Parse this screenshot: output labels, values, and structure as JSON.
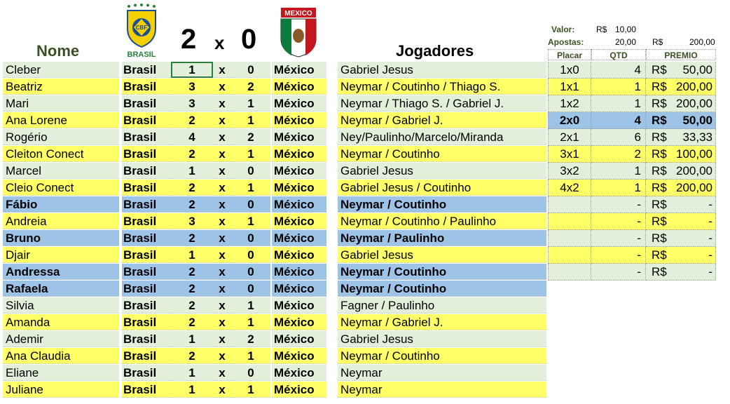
{
  "header": {
    "nome_label": "Nome",
    "jogadores_label": "Jogadores",
    "score_home": "2",
    "score_x": "x",
    "score_away": "0",
    "brasil_logo_text": "CBF",
    "brasil_logo_caption": "BRASIL",
    "mexico_logo_caption": "MEXICO"
  },
  "info": {
    "valor_label": "Valor:",
    "valor_currency": "R$",
    "valor_value": "10,00",
    "apostas_label": "Apostas:",
    "apostas_value": "20,00",
    "total_currency": "R$",
    "total_value": "200,00"
  },
  "colors": {
    "green_row": "#e2efda",
    "yellow_row": "#ffff66",
    "blue_row": "#9dc3e6",
    "header_green": "#3d4f24"
  },
  "bets": [
    {
      "nome": "Cleber",
      "time1": "Brasil",
      "g1": "1",
      "x": "x",
      "g2": "0",
      "time2": "México",
      "jogadores": "Gabriel Jesus",
      "color": "#e2efda",
      "winner": false
    },
    {
      "nome": "Beatriz",
      "time1": "Brasil",
      "g1": "3",
      "x": "x",
      "g2": "2",
      "time2": "México",
      "jogadores": "Neymar / Coutinho / Thiago S.",
      "color": "#ffff66",
      "winner": false
    },
    {
      "nome": "Mari",
      "time1": "Brasil",
      "g1": "3",
      "x": "x",
      "g2": "1",
      "time2": "México",
      "jogadores": "Neymar / Thiago S. / Gabriel J.",
      "color": "#e2efda",
      "winner": false
    },
    {
      "nome": "Ana Lorene",
      "time1": "Brasil",
      "g1": "2",
      "x": "x",
      "g2": "1",
      "time2": "México",
      "jogadores": "Neymar / Gabriel J.",
      "color": "#ffff66",
      "winner": false
    },
    {
      "nome": "Rogério",
      "time1": "Brasil",
      "g1": "4",
      "x": "x",
      "g2": "2",
      "time2": "México",
      "jogadores": "Ney/Paulinho/Marcelo/Miranda",
      "color": "#e2efda",
      "winner": false
    },
    {
      "nome": "Cleiton Conect",
      "time1": "Brasil",
      "g1": "2",
      "x": "x",
      "g2": "1",
      "time2": "México",
      "jogadores": "Neymar / Coutinho",
      "color": "#ffff66",
      "winner": false
    },
    {
      "nome": "Marcel",
      "time1": "Brasil",
      "g1": "1",
      "x": "x",
      "g2": "0",
      "time2": "México",
      "jogadores": "Gabriel Jesus",
      "color": "#e2efda",
      "winner": false
    },
    {
      "nome": "Cleio Conect",
      "time1": "Brasil",
      "g1": "2",
      "x": "x",
      "g2": "1",
      "time2": "México",
      "jogadores": "Gabriel Jesus / Coutinho",
      "color": "#ffff66",
      "winner": false
    },
    {
      "nome": "Fábio",
      "time1": "Brasil",
      "g1": "2",
      "x": "x",
      "g2": "0",
      "time2": "México",
      "jogadores": "Neymar / Coutinho",
      "color": "#9dc3e6",
      "winner": true
    },
    {
      "nome": "Andreia",
      "time1": "Brasil",
      "g1": "3",
      "x": "x",
      "g2": "1",
      "time2": "México",
      "jogadores": "Neymar / Coutinho / Paulinho",
      "color": "#ffff66",
      "winner": false
    },
    {
      "nome": "Bruno",
      "time1": "Brasil",
      "g1": "2",
      "x": "x",
      "g2": "0",
      "time2": "México",
      "jogadores": "Neymar / Paulinho",
      "color": "#9dc3e6",
      "winner": true
    },
    {
      "nome": "Djair",
      "time1": "Brasil",
      "g1": "1",
      "x": "x",
      "g2": "0",
      "time2": "México",
      "jogadores": "Gabriel Jesus",
      "color": "#ffff66",
      "winner": false
    },
    {
      "nome": "Andressa",
      "time1": "Brasil",
      "g1": "2",
      "x": "x",
      "g2": "0",
      "time2": "México",
      "jogadores": "Neymar / Coutinho",
      "color": "#9dc3e6",
      "winner": true
    },
    {
      "nome": "Rafaela",
      "time1": "Brasil",
      "g1": "2",
      "x": "x",
      "g2": "0",
      "time2": "México",
      "jogadores": "Neymar / Coutinho",
      "color": "#9dc3e6",
      "winner": true
    },
    {
      "nome": "Silvia",
      "time1": "Brasil",
      "g1": "2",
      "x": "x",
      "g2": "1",
      "time2": "México",
      "jogadores": "Fagner / Paulinho",
      "color": "#e2efda",
      "winner": false
    },
    {
      "nome": "Amanda",
      "time1": "Brasil",
      "g1": "2",
      "x": "x",
      "g2": "1",
      "time2": "México",
      "jogadores": "Neymar / Gabriel J.",
      "color": "#ffff66",
      "winner": false
    },
    {
      "nome": "Ademir",
      "time1": "Brasil",
      "g1": "1",
      "x": "x",
      "g2": "2",
      "time2": "México",
      "jogadores": "Gabriel Jesus",
      "color": "#e2efda",
      "winner": false
    },
    {
      "nome": "Ana Claudia",
      "time1": "Brasil",
      "g1": "2",
      "x": "x",
      "g2": "1",
      "time2": "México",
      "jogadores": "Neymar / Coutinho",
      "color": "#ffff66",
      "winner": false
    },
    {
      "nome": "Eliane",
      "time1": "Brasil",
      "g1": "1",
      "x": "x",
      "g2": "0",
      "time2": "México",
      "jogadores": "Neymar",
      "color": "#e2efda",
      "winner": false
    },
    {
      "nome": "Juliane",
      "time1": "Brasil",
      "g1": "1",
      "x": "x",
      "g2": "1",
      "time2": "México",
      "jogadores": "Neymar",
      "color": "#ffff66",
      "winner": false
    }
  ],
  "prize_table": {
    "headers": [
      "Placar",
      "QTD",
      "PREMIO"
    ],
    "rows": [
      {
        "placar": "1x0",
        "qtd": "4",
        "currency": "R$",
        "premio": "50,00",
        "color": "#e2efda",
        "highlight": false
      },
      {
        "placar": "1x1",
        "qtd": "1",
        "currency": "R$",
        "premio": "200,00",
        "color": "#ffff66",
        "highlight": false
      },
      {
        "placar": "1x2",
        "qtd": "1",
        "currency": "R$",
        "premio": "200,00",
        "color": "#e2efda",
        "highlight": false
      },
      {
        "placar": "2x0",
        "qtd": "4",
        "currency": "R$",
        "premio": "50,00",
        "color": "#9dc3e6",
        "highlight": true
      },
      {
        "placar": "2x1",
        "qtd": "6",
        "currency": "R$",
        "premio": "33,33",
        "color": "#e2efda",
        "highlight": false
      },
      {
        "placar": "3x1",
        "qtd": "2",
        "currency": "R$",
        "premio": "100,00",
        "color": "#ffff66",
        "highlight": false
      },
      {
        "placar": "3x2",
        "qtd": "1",
        "currency": "R$",
        "premio": "200,00",
        "color": "#e2efda",
        "highlight": false
      },
      {
        "placar": "4x2",
        "qtd": "1",
        "currency": "R$",
        "premio": "200,00",
        "color": "#ffff66",
        "highlight": false
      },
      {
        "placar": "",
        "qtd": "-",
        "currency": "R$",
        "premio": "-",
        "color": "#e2efda",
        "highlight": false
      },
      {
        "placar": "",
        "qtd": "-",
        "currency": "R$",
        "premio": "-",
        "color": "#ffff66",
        "highlight": false
      },
      {
        "placar": "",
        "qtd": "-",
        "currency": "R$",
        "premio": "-",
        "color": "#e2efda",
        "highlight": false
      },
      {
        "placar": "",
        "qtd": "-",
        "currency": "R$",
        "premio": "-",
        "color": "#ffff66",
        "highlight": false
      },
      {
        "placar": "",
        "qtd": "-",
        "currency": "R$",
        "premio": "-",
        "color": "#e2efda",
        "highlight": false
      }
    ]
  }
}
